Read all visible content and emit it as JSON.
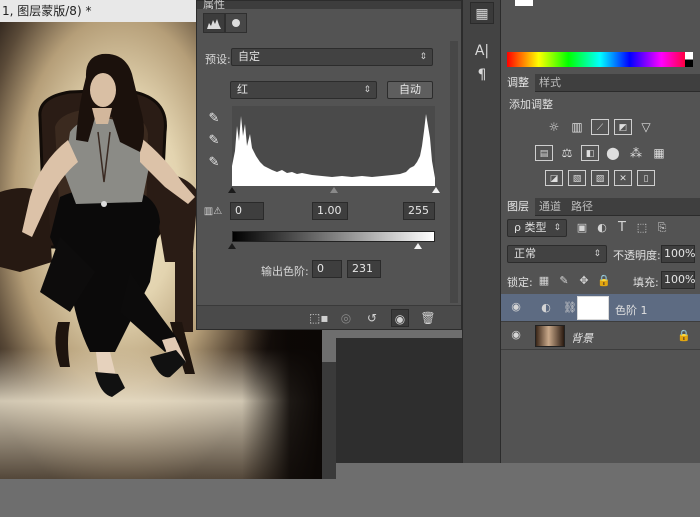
{
  "document": {
    "tab_title": "1, 图层蒙版/8) *"
  },
  "properties": {
    "panel_title": "属性",
    "preset_label": "预设:",
    "preset_value": "自定",
    "channel_value": "红",
    "auto_button": "自动",
    "input_black": "0",
    "input_gamma": "1.00",
    "input_white": "255",
    "output_label": "输出色阶:",
    "output_black": "0",
    "output_white": "231"
  },
  "adjustments": {
    "tabs": [
      "调整",
      "样式"
    ],
    "title": "添加调整"
  },
  "layers": {
    "tabs": [
      "图层",
      "通道",
      "路径"
    ],
    "filter_label": "ρ 类型",
    "blend_mode": "正常",
    "opacity_label": "不透明度:",
    "opacity_value": "100%",
    "lock_label": "锁定:",
    "fill_label": "填充:",
    "fill_value": "100%",
    "rows": [
      {
        "name": "色阶 1",
        "selected": true
      },
      {
        "name": "背景",
        "selected": false
      }
    ]
  },
  "colors": {
    "panel_bg": "#535353",
    "selected_row": "#5d6b82",
    "accent_white": "#ffffff"
  }
}
